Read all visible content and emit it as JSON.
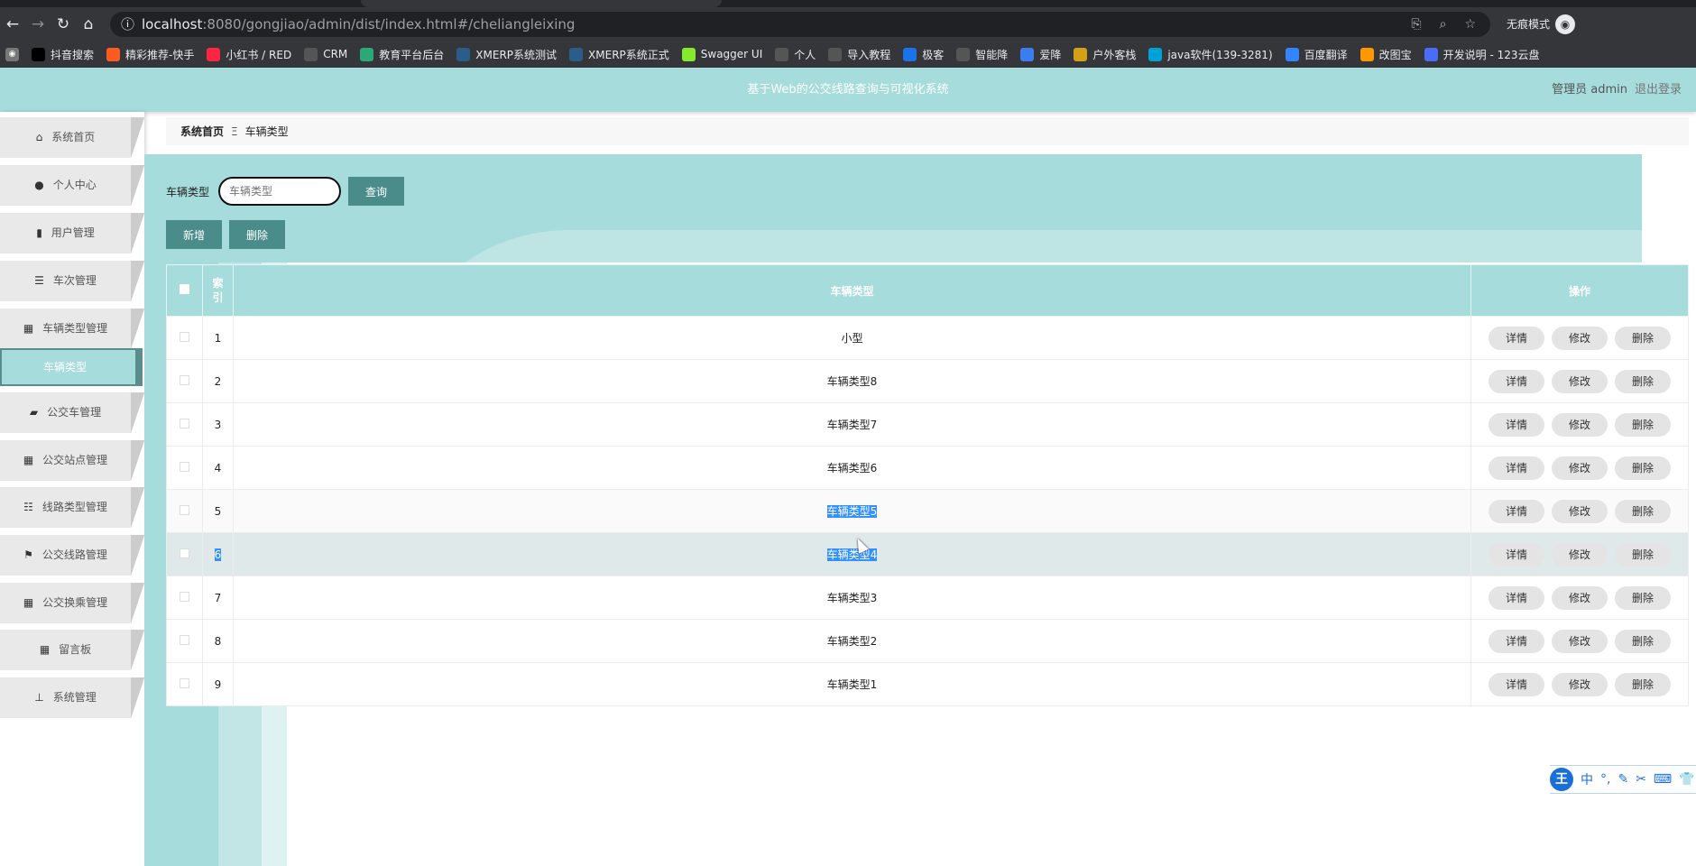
{
  "browser": {
    "url_host": "localhost",
    "url_rest": ":8080/gongjiao/admin/dist/index.html#/cheliangleixing",
    "incognito_label": "无痕模式",
    "bookmarks": [
      {
        "label": "抖音搜索",
        "color": "#000"
      },
      {
        "label": "精彩推荐-快手",
        "color": "#ff5a1f"
      },
      {
        "label": "小红书 / RED",
        "color": "#ff2442"
      },
      {
        "label": "CRM",
        "color": "#555"
      },
      {
        "label": "教育平台后台",
        "color": "#2aa876"
      },
      {
        "label": "XMERP系统测试",
        "color": "#2a5d8a"
      },
      {
        "label": "XMERP系统正式",
        "color": "#2a5d8a"
      },
      {
        "label": "Swagger UI",
        "color": "#85ea2d"
      },
      {
        "label": "个人",
        "color": "#555"
      },
      {
        "label": "导入教程",
        "color": "#555"
      },
      {
        "label": "极客",
        "color": "#1a73e8"
      },
      {
        "label": "智能降",
        "color": "#555"
      },
      {
        "label": "爱降",
        "color": "#3b7cf0"
      },
      {
        "label": "户外客栈",
        "color": "#d4a017"
      },
      {
        "label": "java软件(139-3281)",
        "color": "#00a1d6"
      },
      {
        "label": "百度翻译",
        "color": "#3385ff"
      },
      {
        "label": "改图宝",
        "color": "#ff9800"
      },
      {
        "label": "开发说明 - 123云盘",
        "color": "#4a6cf7"
      }
    ]
  },
  "header": {
    "title": "基于Web的公交线路查询与可视化系统",
    "user": "管理员 admin",
    "logout": "退出登录"
  },
  "sidebar": {
    "items": [
      {
        "label": "系统首页",
        "icon": "⌂"
      },
      {
        "label": "个人中心",
        "icon": "●"
      },
      {
        "label": "用户管理",
        "icon": "▮"
      },
      {
        "label": "车次管理",
        "icon": "☰"
      },
      {
        "label": "车辆类型管理",
        "icon": "▦"
      },
      {
        "label": "公交车管理",
        "icon": "▰"
      },
      {
        "label": "公交站点管理",
        "icon": "▦"
      },
      {
        "label": "线路类型管理",
        "icon": "☷"
      },
      {
        "label": "公交线路管理",
        "icon": "⚑"
      },
      {
        "label": "公交换乘管理",
        "icon": "▦"
      },
      {
        "label": "留言板",
        "icon": "▦"
      },
      {
        "label": "系统管理",
        "icon": "⊥"
      }
    ],
    "active_sub": "车辆类型"
  },
  "breadcrumb": {
    "home": "系统首页",
    "sep": "Ξ",
    "current": "车辆类型"
  },
  "search": {
    "label": "车辆类型",
    "placeholder": "车辆类型",
    "button": "查询"
  },
  "actions": {
    "add": "新增",
    "delete": "删除"
  },
  "table": {
    "headers": {
      "index": "索引",
      "type": "车辆类型",
      "ops": "操作"
    },
    "rows": [
      {
        "i": "1",
        "type": "小型"
      },
      {
        "i": "2",
        "type": "车辆类型8"
      },
      {
        "i": "3",
        "type": "车辆类型7"
      },
      {
        "i": "4",
        "type": "车辆类型6"
      },
      {
        "i": "5",
        "type": "车辆类型5"
      },
      {
        "i": "6",
        "type": "车辆类型4"
      },
      {
        "i": "7",
        "type": "车辆类型3"
      },
      {
        "i": "8",
        "type": "车辆类型2"
      },
      {
        "i": "9",
        "type": "车辆类型1"
      }
    ],
    "op_labels": {
      "detail": "详情",
      "edit": "修改",
      "delete": "删除"
    }
  },
  "ime": {
    "logo": "王",
    "mode": "中",
    "punct": "°,"
  }
}
